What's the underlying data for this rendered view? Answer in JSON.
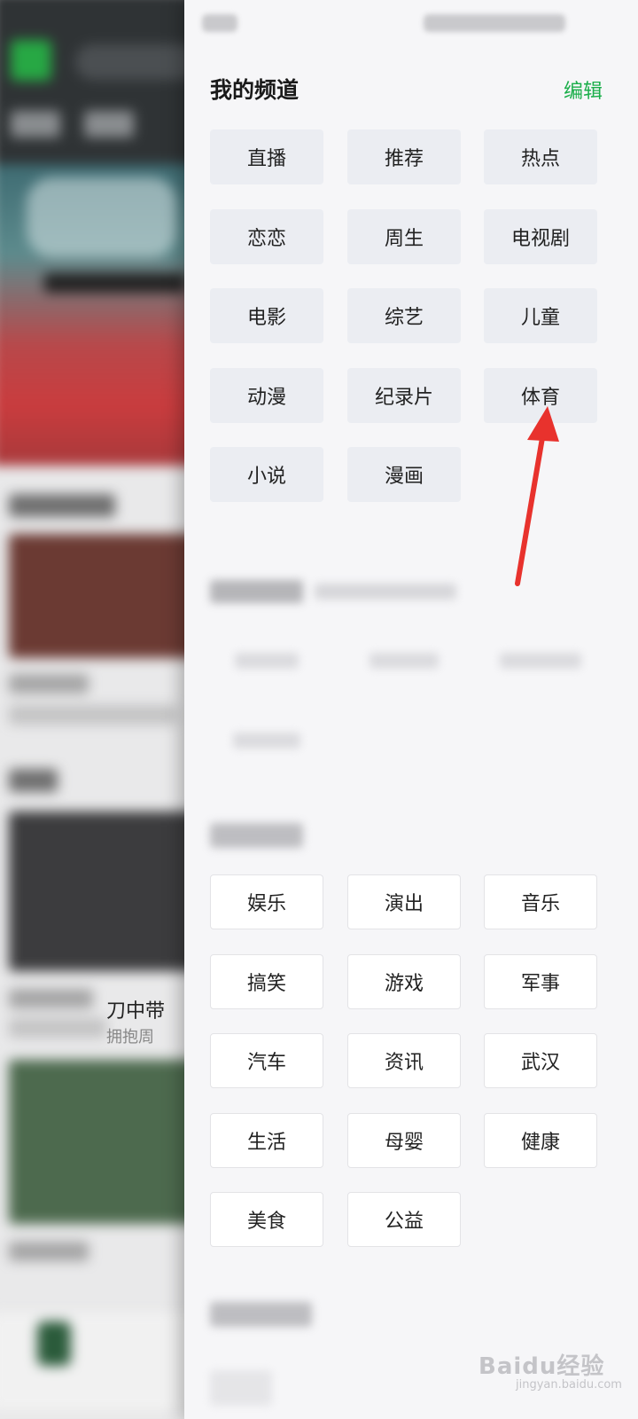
{
  "drawer": {
    "title": "我的频道",
    "edit_label": "编辑"
  },
  "my_channels": [
    "直播",
    "推荐",
    "热点",
    "恋恋",
    "周生",
    "电视剧",
    "电影",
    "综艺",
    "儿童",
    "动漫",
    "纪录片",
    "体育",
    "小说",
    "漫画"
  ],
  "more_channels": [
    "娱乐",
    "演出",
    "音乐",
    "搞笑",
    "游戏",
    "军事",
    "汽车",
    "资讯",
    "武汉",
    "生活",
    "母婴",
    "健康",
    "美食",
    "公益"
  ],
  "background": {
    "feed_text_1": "刀中带",
    "feed_text_2": "拥抱周"
  },
  "annotation": {
    "arrow_color": "#e8322d",
    "target": "体育"
  },
  "watermark": {
    "text": "Baidu经验",
    "sub": "jingyan.baidu.com"
  },
  "colors": {
    "accent": "#1bae4a",
    "chip_bg": "#ebedf2"
  }
}
